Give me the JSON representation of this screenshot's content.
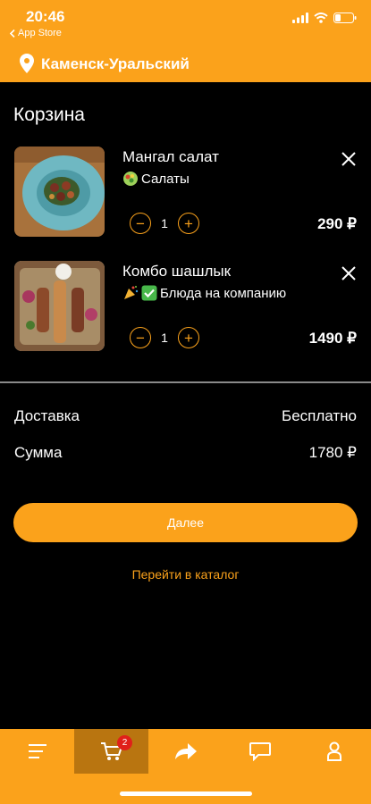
{
  "status": {
    "time": "20:46",
    "back_label": "App Store"
  },
  "header": {
    "city": "Каменск-Уральский"
  },
  "cart": {
    "title": "Корзина",
    "items": [
      {
        "name": "Мангал салат",
        "category_icon": "salad-emoji",
        "category": "Салаты",
        "quantity": "1",
        "price": "290 ₽"
      },
      {
        "name": "Комбо шашлык",
        "category_icon": "party-check-emoji",
        "category": "Блюда на компанию",
        "quantity": "1",
        "price": "1490 ₽"
      }
    ],
    "delivery_label": "Доставка",
    "delivery_value": "Бесплатно",
    "sum_label": "Сумма",
    "sum_value": "1780 ₽",
    "next_button": "Далее",
    "catalog_link": "Перейти в каталог"
  },
  "tabbar": {
    "items": [
      {
        "icon": "menu-icon"
      },
      {
        "icon": "cart-icon",
        "badge": "2",
        "active": true
      },
      {
        "icon": "share-icon"
      },
      {
        "icon": "chat-icon"
      },
      {
        "icon": "profile-icon"
      }
    ]
  },
  "colors": {
    "accent": "#fba21b",
    "background": "#000000",
    "badge": "#e0201a"
  }
}
